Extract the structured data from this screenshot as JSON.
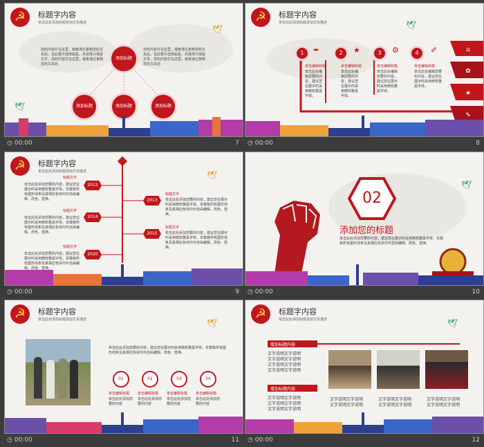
{
  "slides": [
    {
      "number": "7",
      "time": "00:00",
      "title": "标题字内容",
      "subtitle": "单击此处添加标题添加文本描述",
      "center_label": "添加标题",
      "nodes": [
        "添加标题",
        "添加标题",
        "添加标题"
      ],
      "left_text": "您的内容打在这里，或者通过复制您的文本后，在此框中选择粘贴，并选择只保留文字。您的内容打在这里，或者通过复制您的文本后",
      "right_text": "您的内容打在这里，或者通过复制您的文本后，在此框中选择粘贴，并选择只保留文字。您的内容打在这里，或者通过复制您的文本后"
    },
    {
      "number": "8",
      "time": "00:00",
      "title": "标题字内容",
      "subtitle": "单击此处添加标题添加文本描述",
      "steps": [
        {
          "num": "1",
          "label": "单击编辑标题",
          "text": "单击此处编辑您要的内容，建议您在展示时采用微软雅黑字体。"
        },
        {
          "num": "2",
          "label": "单击编辑标题",
          "text": "单击此处编辑您要的内容，建议您在展示时采用微软雅黑字体。"
        },
        {
          "num": "3",
          "label": "单击编辑标题",
          "text": "单击此处编辑您要的内容，建议您在展示时采用微软雅黑字体。"
        },
        {
          "num": "4",
          "label": "单击编辑标题",
          "text": "单击此处编辑您要的内容，建议您在展示时采用微软雅黑字体。"
        }
      ]
    },
    {
      "number": "9",
      "time": "00:00",
      "title": "标题字内容",
      "subtitle": "单击此处添加标题添加文本描述",
      "years": [
        "2012",
        "2013",
        "2014",
        "2015",
        "2020"
      ],
      "heading": "标题文字",
      "body": "单击此处添加您要的内容，建议您在展示时采用微软雅黑字体，本模板所有图形线条及其相应色块均可自由编辑、改色、替换。"
    },
    {
      "number": "10",
      "time": "00:00",
      "section_number": "02",
      "section_title": "添加您的标题",
      "section_text": "单击此处添加您要的内容，建议您在展示时采用微软雅黑字体，本模板所有图形线条及其相应色块均可自由编辑、改色、替换。"
    },
    {
      "number": "11",
      "time": "00:00",
      "title": "标题字内容",
      "subtitle": "单击此处添加标题添加文本描述",
      "body": "单击此处添加您要的内容，建议您在展示时采用微软雅黑字体，本模板所有图形线条及其相应色块均可自由编辑、改色、替换。",
      "items": [
        {
          "num": "01",
          "label": "单击编辑标题",
          "text": "单击此处添加您要的内容"
        },
        {
          "num": "02",
          "label": "单击编辑标题",
          "text": "单击此处添加您要的内容"
        },
        {
          "num": "03",
          "label": "单击编辑标题",
          "text": "单击此处添加您要的内容"
        },
        {
          "num": "04",
          "label": "单击编辑标题",
          "text": "单击此处添加您要的内容"
        }
      ]
    },
    {
      "number": "12",
      "time": "00:00",
      "title": "标题字内容",
      "subtitle": "单击此处添加标题添加文本描述",
      "tag1": "增加标题内容",
      "tag2": "增加标题内容",
      "lines": [
        "文字说明文字说明",
        "文字说明文字说明",
        "文字说明文字说明"
      ],
      "captions": [
        "文字说明文字说明",
        "文字说明文字说明",
        "文字说明文字说明"
      ]
    }
  ]
}
